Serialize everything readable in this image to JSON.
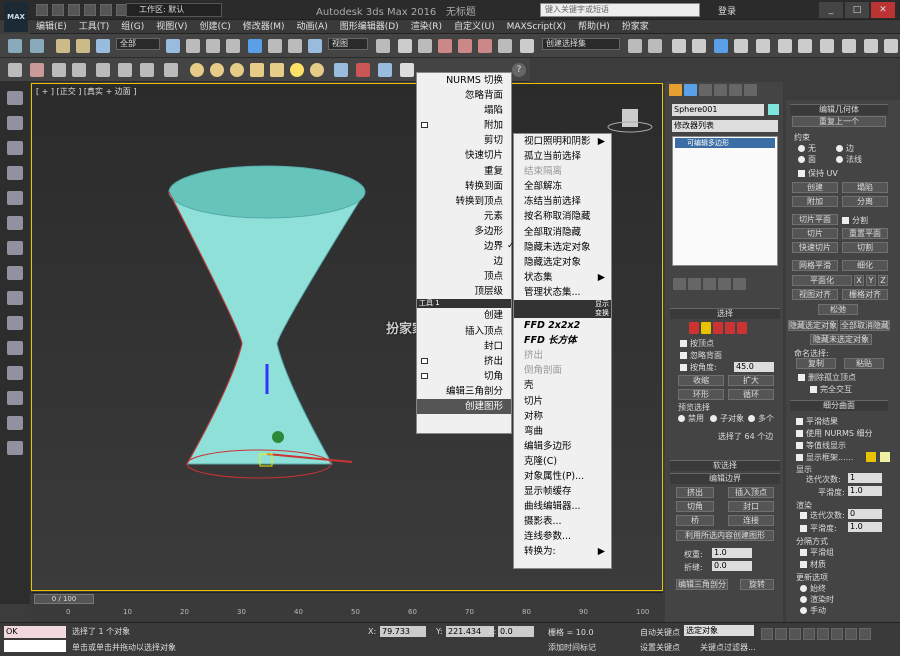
{
  "window": {
    "title": "Autodesk 3ds Max 2016",
    "subtitle": "无标题",
    "workspace": "工作区: 默认",
    "search_placeholder": "键入关键字或短语",
    "login": "登录",
    "app_badge": "MAX"
  },
  "menubar": [
    "编辑(E)",
    "工具(T)",
    "组(G)",
    "视图(V)",
    "创建(C)",
    "修改器(M)",
    "动画(A)",
    "图形编辑器(D)",
    "渲染(R)",
    "自定义(U)",
    "MAXScript(X)",
    "帮助(H)",
    "扮家家"
  ],
  "toolbar": {
    "filter": "全部",
    "ref_coord": "视图",
    "selection_set": "创建选择集"
  },
  "viewport": {
    "label": "[ + ] [正交 ] [真实 + 边面 ]"
  },
  "quad_left": [
    {
      "label": "NURMS 切换",
      "italic": true
    },
    {
      "label": "忽略背面"
    },
    {
      "label": "塌陷"
    },
    {
      "label": "附加",
      "box": true
    },
    {
      "label": "剪切"
    },
    {
      "label": "快速切片"
    },
    {
      "label": "重复"
    },
    {
      "label": "转换到面"
    },
    {
      "label": "转换到顶点"
    },
    {
      "label": "元素"
    },
    {
      "label": "多边形"
    },
    {
      "label": "边界",
      "check": "✓"
    },
    {
      "label": "边"
    },
    {
      "label": "顶点"
    },
    {
      "label": "顶层级"
    },
    {
      "label": "工具 1",
      "header": true
    },
    {
      "label": "创建"
    },
    {
      "label": "插入顶点"
    },
    {
      "label": "封口"
    },
    {
      "label": "挤出",
      "box": true
    },
    {
      "label": "切角",
      "box": true
    },
    {
      "label": "编辑三角剖分"
    },
    {
      "label": "创建图形",
      "highlight": true
    }
  ],
  "quad_right": [
    {
      "label": "视口照明和阴影",
      "arrow": "▶"
    },
    {
      "label": "孤立当前选择"
    },
    {
      "label": "结束隔离",
      "disabled": true
    },
    {
      "label": "全部解冻"
    },
    {
      "label": "冻结当前选择"
    },
    {
      "label": "按名称取消隐藏"
    },
    {
      "label": "全部取消隐藏"
    },
    {
      "label": "隐藏未选定对象"
    },
    {
      "label": "隐藏选定对象"
    },
    {
      "label": "状态集",
      "arrow": "▶"
    },
    {
      "label": "管理状态集..."
    },
    {
      "label": "显示",
      "header": true
    },
    {
      "label": "变换",
      "header": true
    },
    {
      "label": "FFD 2x2x2",
      "bold": true
    },
    {
      "label": "FFD 长方体",
      "bold": true
    },
    {
      "label": "挤出",
      "disabled": true
    },
    {
      "label": "倒角剖面",
      "disabled": true
    },
    {
      "label": "壳"
    },
    {
      "label": "切片"
    },
    {
      "label": "对称"
    },
    {
      "label": "弯曲"
    },
    {
      "label": "编辑多边形"
    },
    {
      "label": "克隆(C)"
    },
    {
      "label": "对象属性(P)..."
    },
    {
      "label": "显示帧缓存"
    },
    {
      "label": "曲线编辑器..."
    },
    {
      "label": "摄影表..."
    },
    {
      "label": "连线参数..."
    },
    {
      "label": "转换为:",
      "arrow": "▶"
    }
  ],
  "watermark": "扮家家室内设计",
  "command_panel": {
    "object_name": "Sphere001",
    "object_color": "#7ee6de",
    "modifier_list": "修改器列表",
    "stack_item": "可编辑多边形",
    "selection": {
      "title": "选择",
      "by_vertex": "按顶点",
      "ignore_backfacing": "忽略背面",
      "by_angle": "按角度:",
      "angle": "45.0",
      "shrink": "收缩",
      "grow": "扩大",
      "ring": "环形",
      "loop": "循环",
      "preview": "预览选择",
      "disabled": "禁用",
      "subobj": "子对象",
      "multi": "多个",
      "status": "选择了 64 个边"
    },
    "soft_selection": "软选择",
    "edit_edges": {
      "title": "编辑边界",
      "extrude": "挤出",
      "insert_vertex": "插入顶点",
      "chamfer": "切角",
      "cap": "封口",
      "bridge": "桥",
      "connect": "连接",
      "create_shape": "利用所选内容创建图形",
      "weight": "权重:",
      "weight_val": "1.0",
      "crease": "折缝:",
      "crease_val": "0.0",
      "edit_tri": "编辑三角剖分",
      "rotate": "旋转"
    }
  },
  "right_panel": {
    "edit_geometry": "编辑几何体",
    "repeat_last": "重复上一个",
    "constraints": "约束",
    "none": "无",
    "edge": "边",
    "face": "面",
    "normal": "法线",
    "preserve_uv": "保持 UV",
    "create": "创建",
    "collapse": "塌陷",
    "attach": "附加",
    "detach": "分离",
    "slice_plane": "切片平面",
    "split": "分割",
    "slice": "切片",
    "reset_plane": "重置平面",
    "quickslice": "快速切片",
    "cut": "切割",
    "meshsmooth": "网格平滑",
    "tessellate": "细化",
    "make_planar": "平面化",
    "x": "X",
    "y": "Y",
    "z": "Z",
    "view_align": "视图对齐",
    "grid_align": "栅格对齐",
    "relax": "松弛",
    "hide_selected": "隐藏选定对象",
    "unhide_all": "全部取消隐藏",
    "hide_unselected": "隐藏未选定对象",
    "named_sel": "命名选择:",
    "copy": "复制",
    "paste": "粘贴",
    "delete_iso": "删除孤立顶点",
    "full_interact": "完全交互",
    "subdivision": "细分曲面",
    "smooth_result": "平滑结果",
    "use_nurms": "使用 NURMS 细分",
    "isoline": "等值线显示",
    "show_cage": "显示框架......",
    "display": "显示",
    "iterations": "迭代次数:",
    "iter_val": "1",
    "smoothness": "平滑度:",
    "smooth_val": "1.0",
    "render": "渲染",
    "render_iter_val": "0",
    "render_smooth_val": "1.0",
    "sep_by": "分隔方式",
    "smoothing_groups": "平滑组",
    "materials": "材质",
    "update": "更新选项",
    "always": "始终",
    "when_rendering": "渲染时",
    "manually": "手动",
    "cage_color1": "#e6c200",
    "cage_color2": "#f0f0a0"
  },
  "timeline": {
    "slider": "0 / 100",
    "ticks": [
      "0",
      "10",
      "20",
      "30",
      "40",
      "50",
      "60",
      "70",
      "80",
      "90",
      "100"
    ]
  },
  "status": {
    "prompt_box": "OK",
    "selected": "选择了 1 个对象",
    "hint": "单击或单击并拖动以选择对象",
    "x_label": "X:",
    "x": "79.733",
    "y_label": "Y:",
    "y": "221.434",
    "z_label": "Z:",
    "z": "0.0",
    "grid": "栅格 = 10.0",
    "add_time_tag": "添加时间标记",
    "auto_key": "自动关键点",
    "set_key": "设置关键点",
    "key_filter": "选定对象",
    "key_filters": "关键点过滤器..."
  }
}
